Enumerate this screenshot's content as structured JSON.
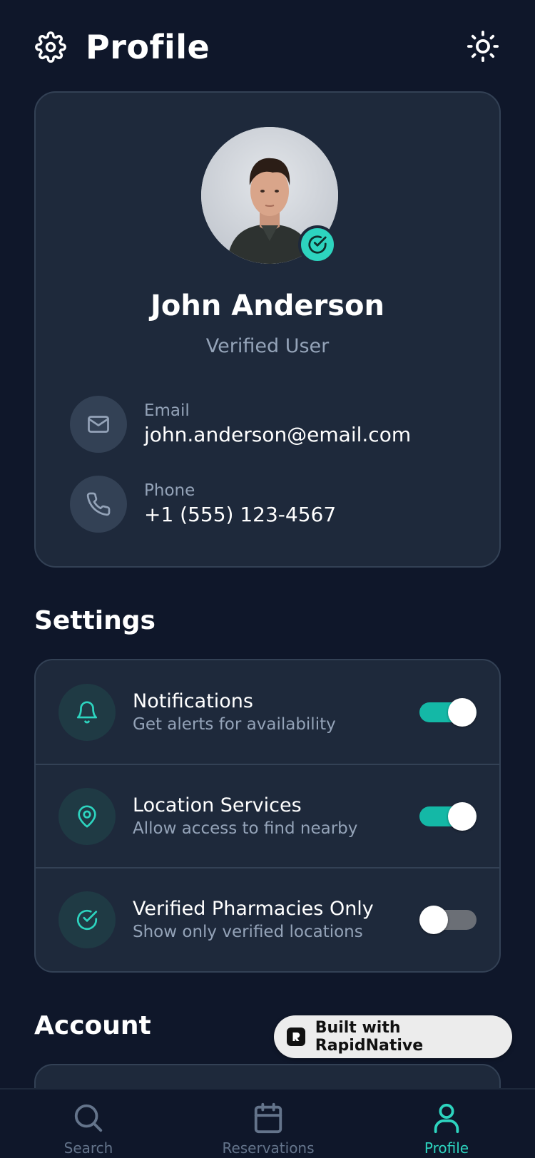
{
  "header": {
    "title": "Profile",
    "settings_icon": "gear-icon",
    "theme_icon": "sun-icon"
  },
  "profile": {
    "name": "John Anderson",
    "status": "Verified User",
    "email_label": "Email",
    "email_value": "john.anderson@email.com",
    "phone_label": "Phone",
    "phone_value": "+1 (555) 123-4567"
  },
  "settings": {
    "title": "Settings",
    "items": [
      {
        "title": "Notifications",
        "subtitle": "Get alerts for availability",
        "icon": "bell-icon",
        "enabled": true
      },
      {
        "title": "Location Services",
        "subtitle": "Allow access to find nearby",
        "icon": "map-pin-icon",
        "enabled": true
      },
      {
        "title": "Verified Pharmacies Only",
        "subtitle": "Show only verified locations",
        "icon": "check-circle-icon",
        "enabled": false
      }
    ]
  },
  "account": {
    "title": "Account"
  },
  "badge": {
    "text": "Built with RapidNative"
  },
  "nav": {
    "items": [
      {
        "label": "Search",
        "icon": "search-icon"
      },
      {
        "label": "Reservations",
        "icon": "calendar-icon"
      },
      {
        "label": "Profile",
        "icon": "user-icon",
        "active": true
      }
    ]
  },
  "colors": {
    "background": "#0f172a",
    "card": "#1e293b",
    "accent": "#2dd4bf",
    "muted": "#94a3b8"
  }
}
